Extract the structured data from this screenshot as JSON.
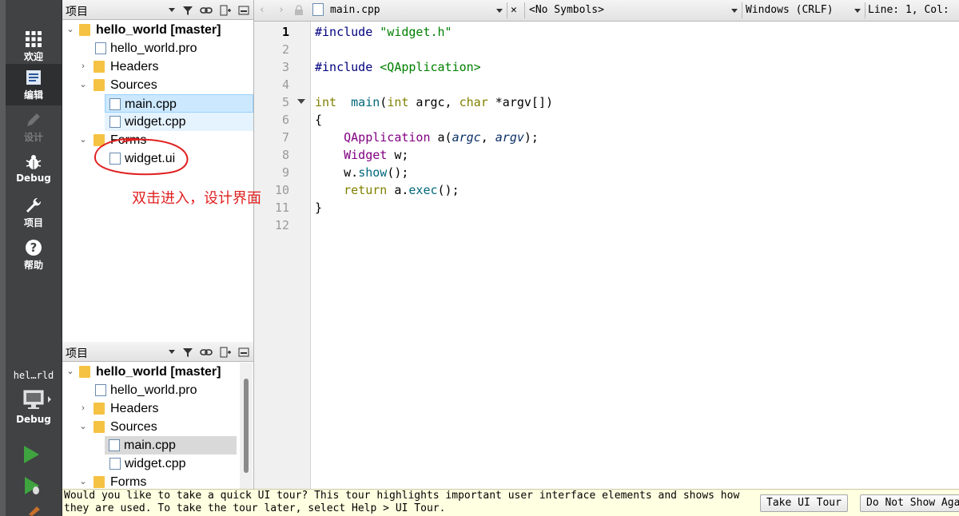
{
  "modebar": {
    "items": [
      {
        "label": "欢迎",
        "icon": "grid-icon",
        "state": "normal"
      },
      {
        "label": "编辑",
        "icon": "document-edit-icon",
        "state": "active"
      },
      {
        "label": "设计",
        "icon": "pencil-icon",
        "state": "disabled"
      },
      {
        "label": "Debug",
        "icon": "bug-icon",
        "state": "normal"
      },
      {
        "label": "项目",
        "icon": "wrench-icon",
        "state": "normal"
      },
      {
        "label": "帮助",
        "icon": "help-icon",
        "state": "normal"
      }
    ],
    "kit": {
      "project": "hel…rld",
      "build": "Debug"
    }
  },
  "pane_top": {
    "title": "项目",
    "tree": [
      {
        "text": "hello_world [master]",
        "kind": "project",
        "expanded": true,
        "bold": true
      },
      {
        "text": "hello_world.pro",
        "kind": "pro-file"
      },
      {
        "text": "Headers",
        "kind": "folder",
        "expanded": false
      },
      {
        "text": "Sources",
        "kind": "folder",
        "expanded": true
      },
      {
        "text": "main.cpp",
        "kind": "cpp-file",
        "state": "selected"
      },
      {
        "text": "widget.cpp",
        "kind": "cpp-file",
        "state": "hover"
      },
      {
        "text": "Forms",
        "kind": "folder",
        "expanded": true
      },
      {
        "text": "widget.ui",
        "kind": "ui-file"
      }
    ]
  },
  "pane_bottom": {
    "title": "项目",
    "tree": [
      {
        "text": "hello_world [master]",
        "kind": "project",
        "expanded": true,
        "bold": true
      },
      {
        "text": "hello_world.pro",
        "kind": "pro-file"
      },
      {
        "text": "Headers",
        "kind": "folder",
        "expanded": false
      },
      {
        "text": "Sources",
        "kind": "folder",
        "expanded": true
      },
      {
        "text": "main.cpp",
        "kind": "cpp-file",
        "state": "selgray"
      },
      {
        "text": "widget.cpp",
        "kind": "cpp-file"
      },
      {
        "text": "Forms",
        "kind": "folder",
        "expanded": true
      }
    ]
  },
  "editor": {
    "file": "main.cpp",
    "symbols": "<No Symbols>",
    "line_ending": "Windows (CRLF)",
    "cursor": "Line: 1, Col:",
    "current_line": 1,
    "lines": [
      "1",
      "2",
      "3",
      "4",
      "5",
      "6",
      "7",
      "8",
      "9",
      "10",
      "11",
      "12"
    ]
  },
  "annotation": {
    "text": "双击进入，设计界面",
    "color": "#e02020"
  },
  "infobar": {
    "message": "Would you like to take a quick UI tour? This tour highlights important user interface elements and shows how\nthey are used. To take the tour later, select Help > UI Tour.",
    "take_tour": "Take UI Tour",
    "do_not_show": "Do Not Show Again"
  },
  "colors": {
    "modebar": "#404244",
    "selection": "#cce8ff",
    "run": "#3fa33f",
    "keyword": "#808000",
    "string": "#008000",
    "type": "#800080"
  }
}
